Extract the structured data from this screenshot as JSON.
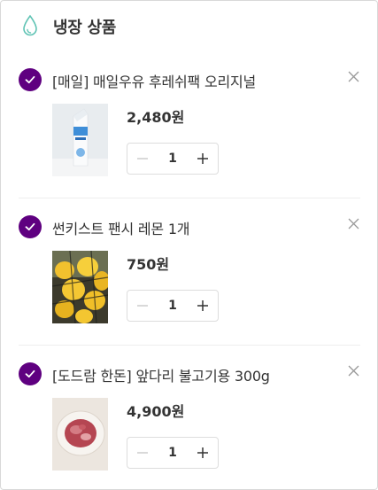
{
  "section": {
    "title": "냉장 상품",
    "icon": "water-drop-icon"
  },
  "colors": {
    "check": "#5f0080",
    "drop": "#5fc3b4"
  },
  "items": [
    {
      "name": "[매일] 매일우유 후레쉬팩 오리지널",
      "price": "2,480원",
      "quantity": "1",
      "selected": true,
      "image": "milk-carton-image"
    },
    {
      "name": "썬키스트 팬시 레몬 1개",
      "price": "750원",
      "quantity": "1",
      "selected": true,
      "image": "lemons-image"
    },
    {
      "name": "[도드람 한돈] 앞다리 불고기용 300g",
      "price": "4,900원",
      "quantity": "1",
      "selected": true,
      "image": "pork-plate-image"
    }
  ]
}
